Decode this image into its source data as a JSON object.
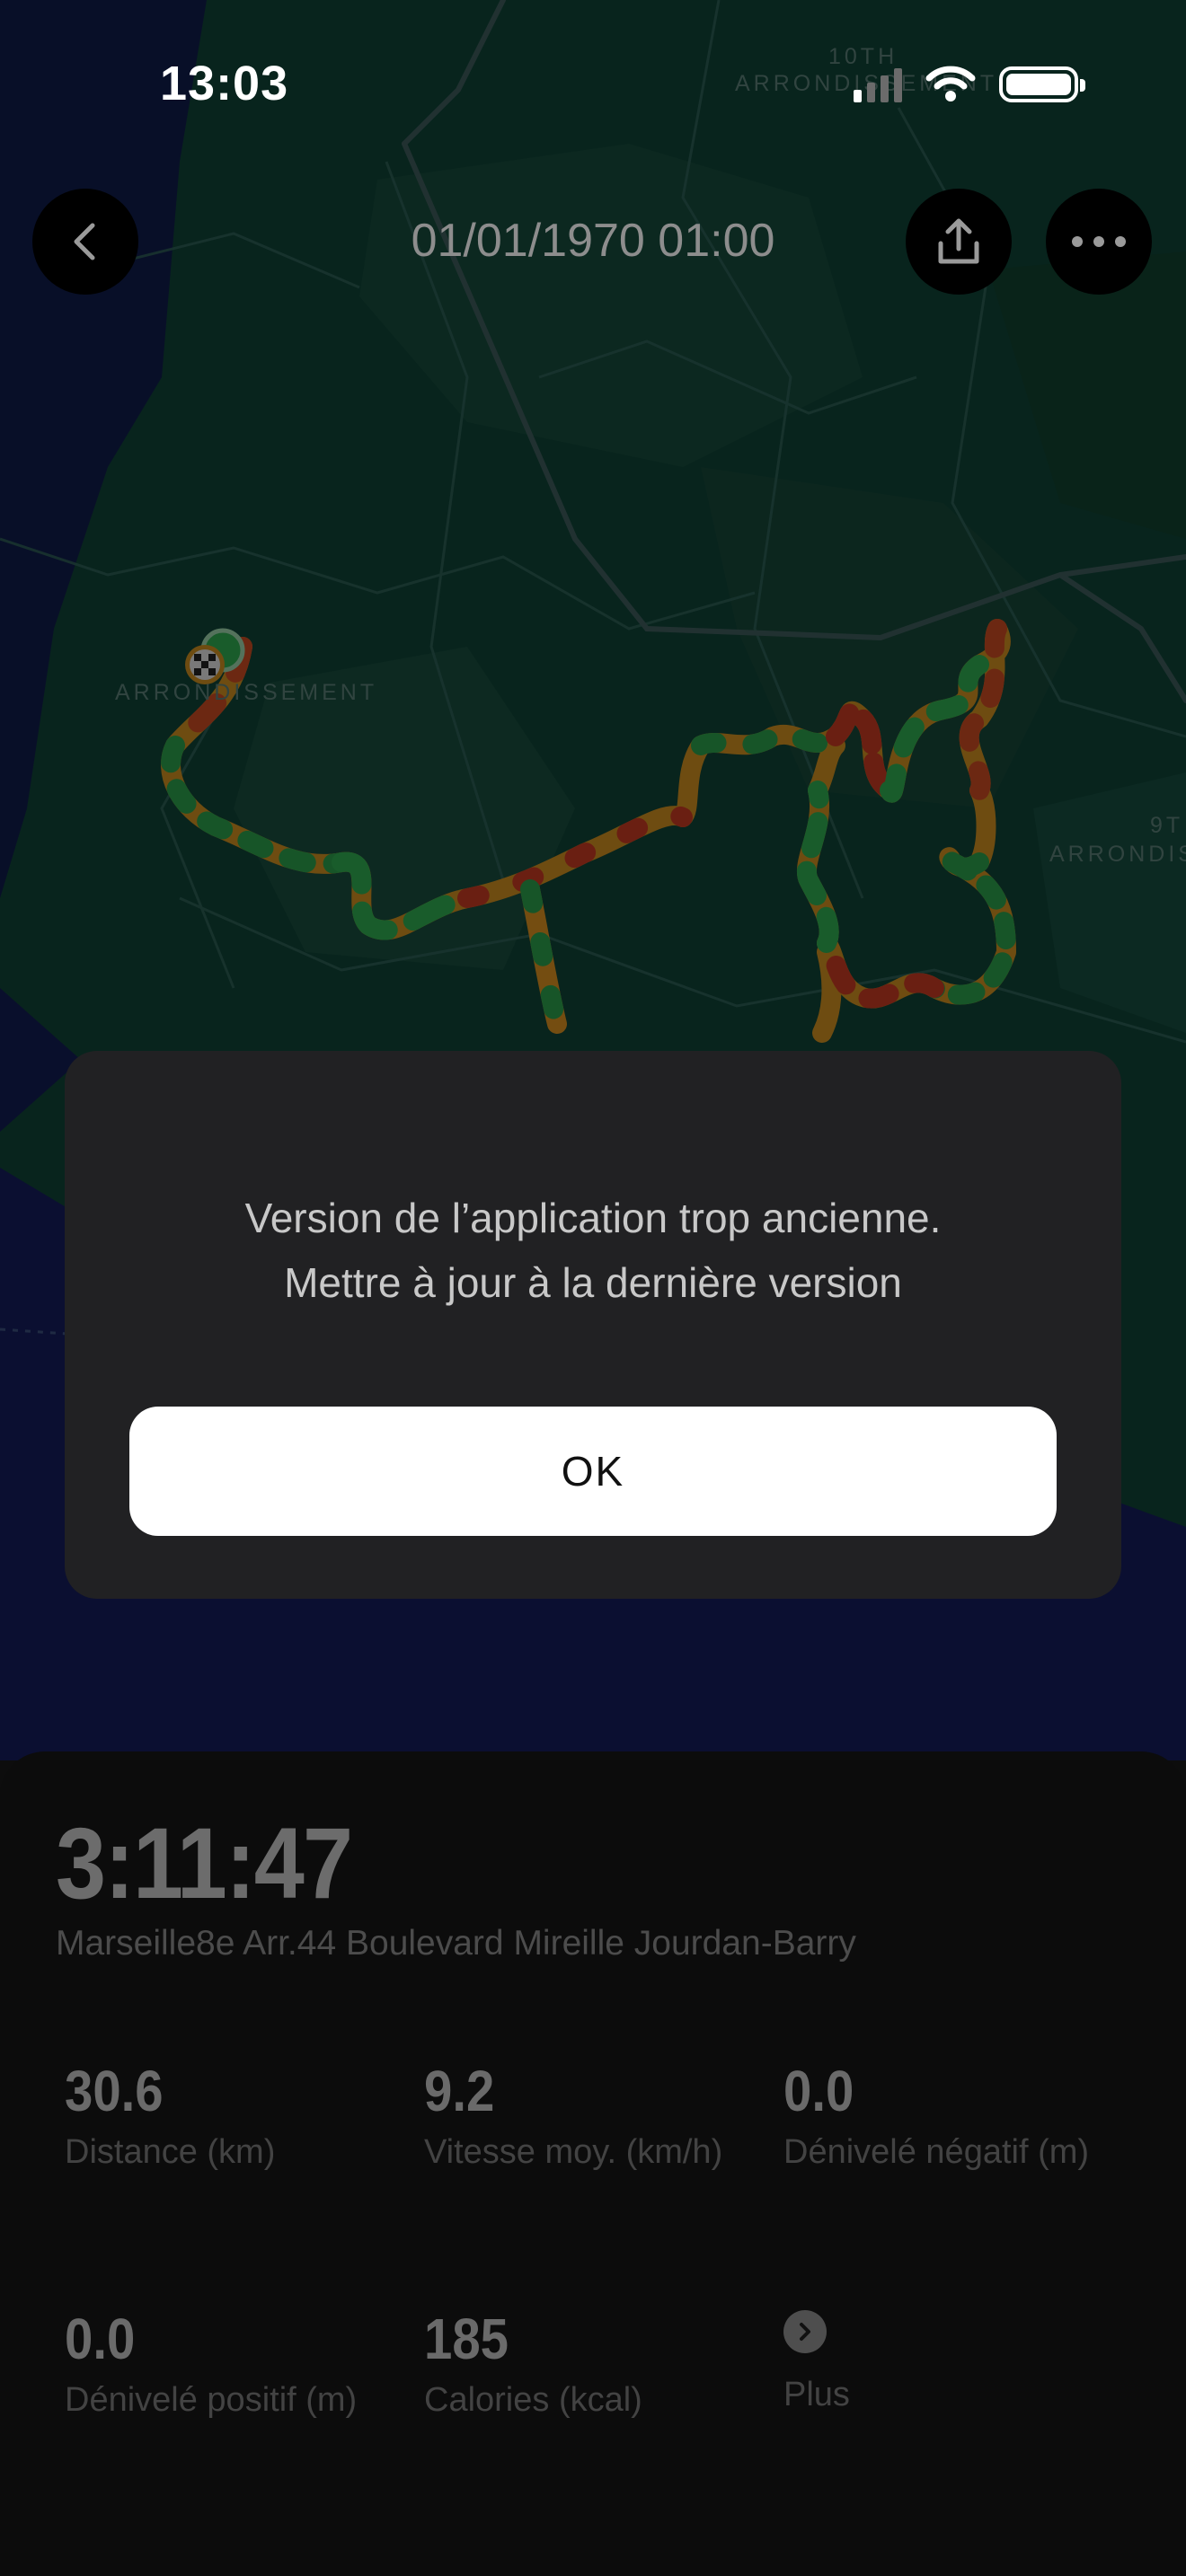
{
  "status_bar": {
    "time": "13:03"
  },
  "header": {
    "title": "01/01/1970 01:00"
  },
  "map": {
    "labels": [
      "10TH",
      "ARRONDISSEMENT",
      "ARRONDISSEMENT",
      "9T",
      "ARRONDIS"
    ]
  },
  "dialog": {
    "message_line1": "Version de l’application trop ancienne.",
    "message_line2": "Mettre à jour à la dernière version",
    "ok_label": "OK"
  },
  "summary": {
    "duration": "3:11:47",
    "address": "Marseille8e Arr.44 Boulevard Mireille Jourdan-Barry"
  },
  "stats": [
    {
      "value": "30.6",
      "label": "Distance (km)"
    },
    {
      "value": "9.2",
      "label": "Vitesse moy. (km/h)"
    },
    {
      "value": "0.0",
      "label": "Dénivelé négatif (m)"
    },
    {
      "value": "0.0",
      "label": "Dénivelé positif (m)"
    },
    {
      "value": "185",
      "label": "Calories (kcal)"
    }
  ],
  "more": {
    "label": "Plus"
  },
  "colors": {
    "route_fast": "#2fa84f",
    "route_mid": "#d98a1c",
    "route_slow": "#c23a22",
    "dialog_bg": "#212123",
    "sheet_bg": "#0c0c0c"
  },
  "icons": [
    "back-icon",
    "share-icon",
    "more-icon",
    "finish-flag-icon",
    "start-marker-icon",
    "wifi-icon",
    "battery-icon",
    "chevron-right-icon"
  ]
}
